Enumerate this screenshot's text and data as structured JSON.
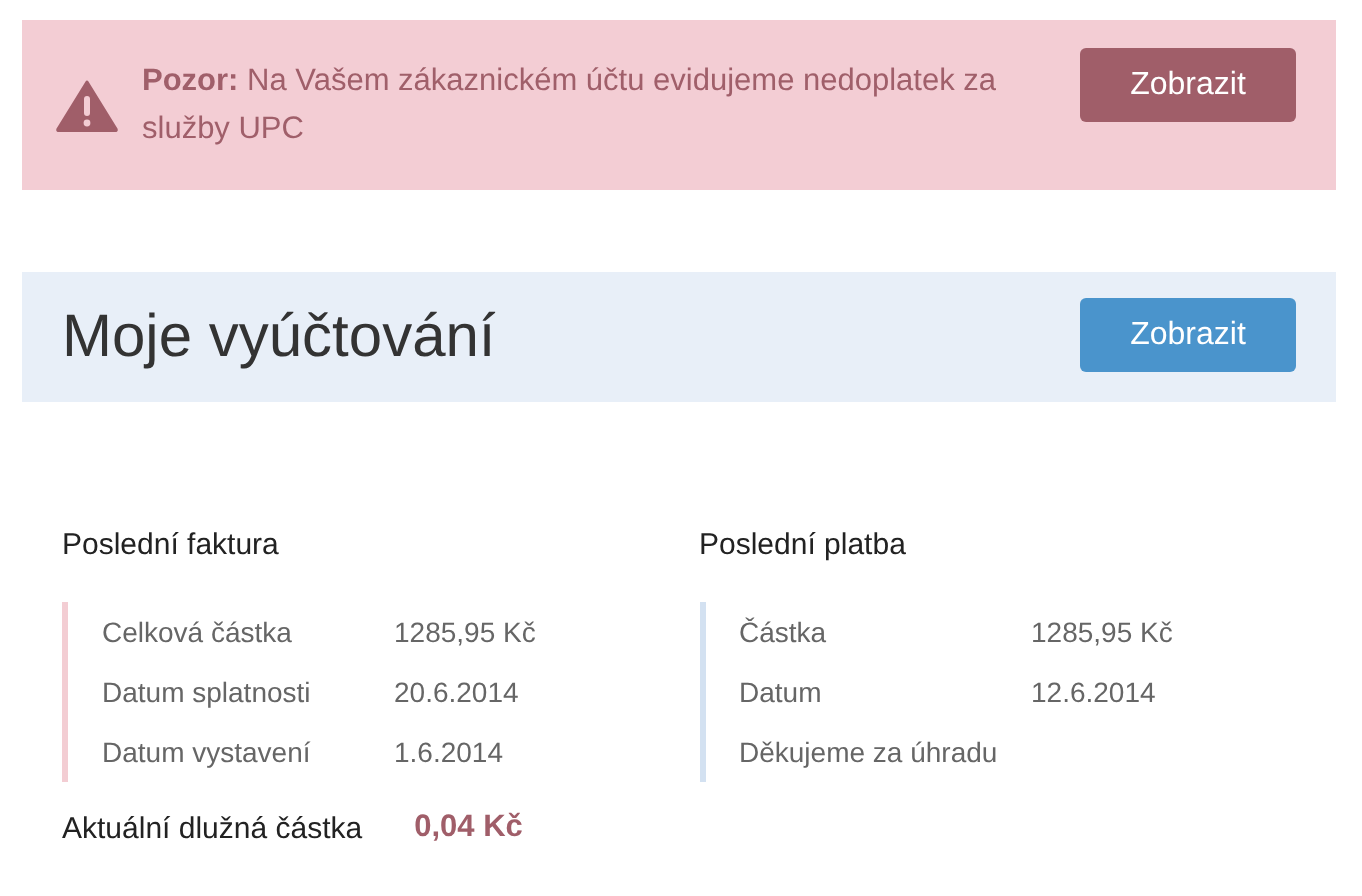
{
  "alert": {
    "text": "**Pozor:** Na Vašem zákaznickém účtu evidujeme nedoplatek za služby UPC",
    "button": "Zobrazit"
  },
  "header": {
    "title": "Moje vyúčtování",
    "button": "Zobrazit"
  },
  "panels": [
    {
      "heading": "Poslední faktura",
      "color": "#f3cdd3",
      "rows": [
        {
          "label": "Celková částka",
          "value": "1285,95 Kč"
        },
        {
          "label": "Datum splatnosti",
          "value": "20.6.2014"
        },
        {
          "label": "Datum vystavení",
          "value": "1.6.2014"
        }
      ]
    },
    {
      "heading": "Poslední platba",
      "color": "#d3e1f1",
      "rows": [
        {
          "label": "Částka",
          "value": "1285,95 Kč"
        },
        {
          "label": "Datum",
          "value": "12.6.2014"
        },
        {
          "label": "Děkujeme za úhradu"
        }
      ]
    }
  ],
  "balance": {
    "label": "Aktuální dlužná částka",
    "amount": "0,04 Kč"
  }
}
